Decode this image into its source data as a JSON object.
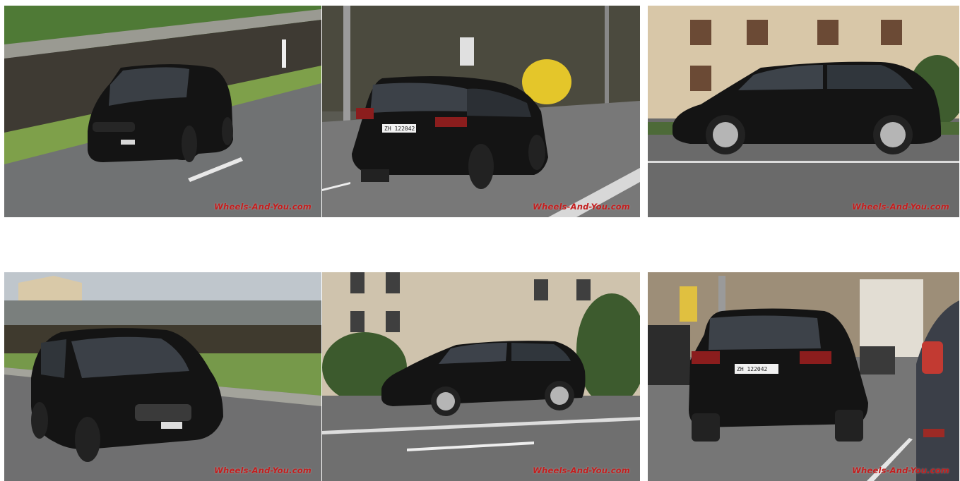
{
  "gallery": {
    "photos": [
      {
        "view": "front three-quarter, driving",
        "watermark": "Wheels-And-You.com"
      },
      {
        "view": "rear three-quarter, driving",
        "watermark": "Wheels-And-You.com",
        "plate": "ZH 122042"
      },
      {
        "view": "side profile, driving",
        "watermark": "Wheels-And-You.com"
      },
      {
        "view": "front three-quarter, cornering",
        "watermark": "Wheels-And-You.com"
      },
      {
        "view": "side profile, distant",
        "watermark": "Wheels-And-You.com"
      },
      {
        "view": "rear, city traffic",
        "watermark": "Wheels-And-You.com",
        "plate": "ZH 122042"
      }
    ]
  },
  "colors": {
    "car_body": "#141414",
    "road": "#6e6e6e",
    "grass": "#5f8a3a",
    "watermark": "#c41e1e"
  }
}
